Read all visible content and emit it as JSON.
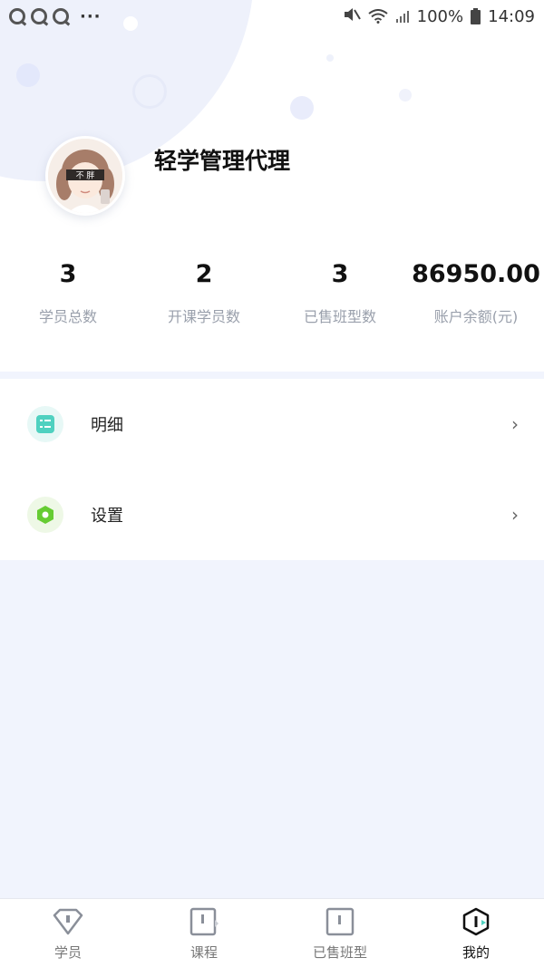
{
  "status_bar": {
    "notifications": [
      "qq-icon",
      "qq-icon",
      "qq-icon"
    ],
    "more": "···",
    "battery": "100%",
    "time": "14:09"
  },
  "profile": {
    "name": "轻学管理代理",
    "avatar_text": "不 胖"
  },
  "stats": [
    {
      "value": "3",
      "label": "学员总数"
    },
    {
      "value": "2",
      "label": "开课学员数"
    },
    {
      "value": "3",
      "label": "已售班型数"
    },
    {
      "value": "86950.00",
      "label": "账户余额(元)"
    }
  ],
  "menu": [
    {
      "label": "明细",
      "icon": "list-icon",
      "color": "#4fd1c0"
    },
    {
      "label": "设置",
      "icon": "settings-hexagon-icon",
      "color": "#66cc33"
    }
  ],
  "nav": [
    {
      "label": "学员",
      "icon": "student-icon",
      "active": false
    },
    {
      "label": "课程",
      "icon": "course-icon",
      "active": false
    },
    {
      "label": "已售班型",
      "icon": "sold-class-icon",
      "active": false
    },
    {
      "label": "我的",
      "icon": "mine-icon",
      "active": true
    }
  ],
  "colors": {
    "page_bg": "#f1f4fd",
    "accent_teal": "#4fd1c0",
    "accent_green": "#66cc33"
  }
}
